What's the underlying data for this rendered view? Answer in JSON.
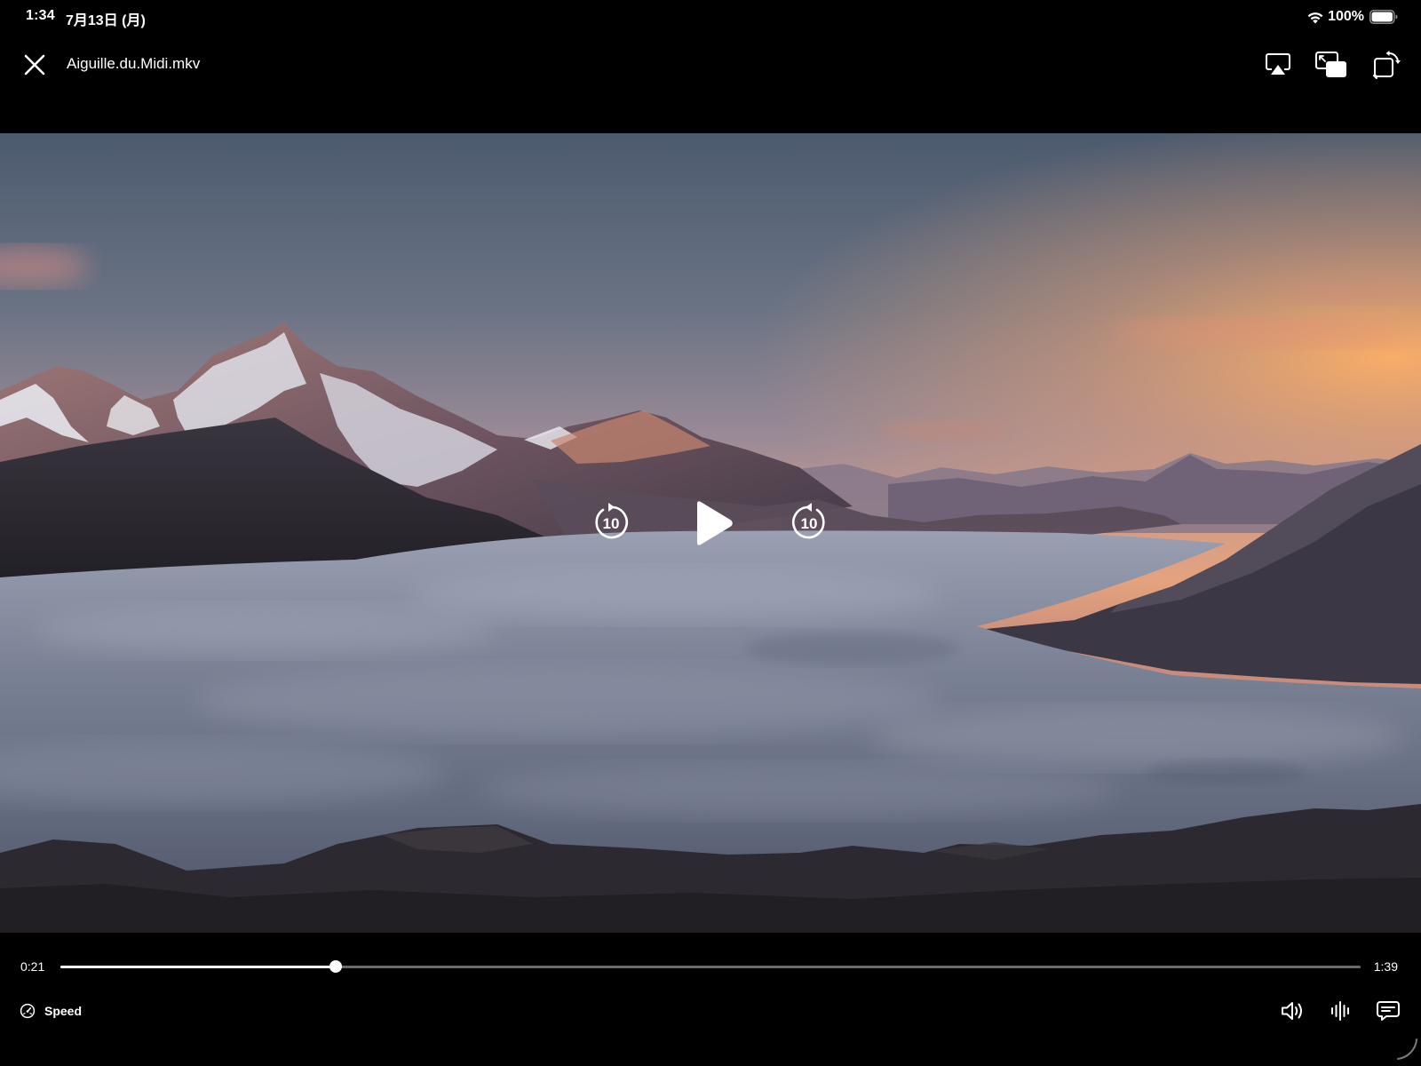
{
  "status_bar": {
    "time": "1:34",
    "date": "7月13日 (月)",
    "battery": "100%",
    "icons": [
      "wifi-icon",
      "battery-icon"
    ]
  },
  "nav": {
    "title": "Aiguille.du.Midi.mkv",
    "icons": [
      "close-icon",
      "airplay-icon",
      "picture-in-picture-icon",
      "rotate-screen-icon"
    ]
  },
  "player": {
    "skip_back_label": "10",
    "skip_forward_label": "10",
    "icons": [
      "skip-back-10-icon",
      "play-icon",
      "skip-forward-10-icon"
    ],
    "current_time": "0:21",
    "total_time": "1:39",
    "progress": 0.212
  },
  "bottom_bar": {
    "speed_label": "Speed",
    "icons": [
      "speedometer-icon",
      "volume-icon",
      "audio-waveform-icon",
      "subtitles-icon"
    ]
  },
  "colors": {
    "background": "#000000",
    "scrubber_track": "#6b6b6b",
    "scrubber_fill": "#ffffff"
  }
}
